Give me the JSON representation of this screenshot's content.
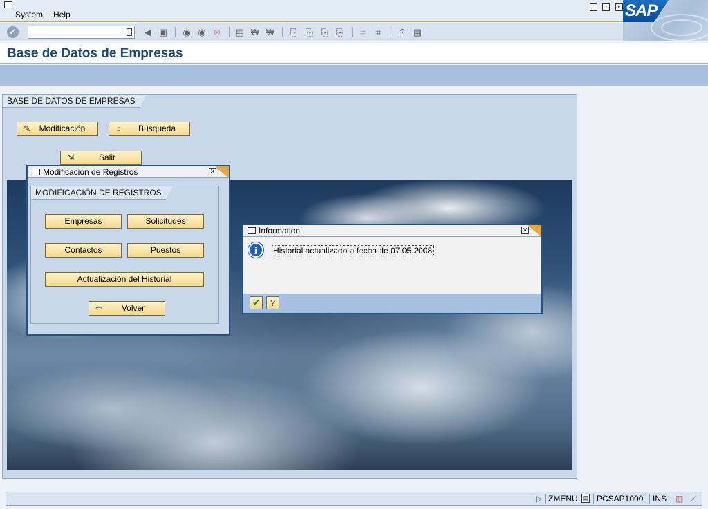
{
  "menubar": {
    "items": [
      "System",
      "Help"
    ]
  },
  "toolbar": {
    "command_field_value": ""
  },
  "title": "Base de Datos de Empresas",
  "main_group": {
    "title": "BASE DE DATOS DE EMPRESAS",
    "buttons": {
      "modificacion": "Modificación",
      "busqueda": "Búsqueda",
      "salir": "Salir"
    }
  },
  "dialog_modificacion": {
    "title": "Modificación de Registros",
    "group_title": "MODIFICACIÓN DE REGISTROS",
    "buttons": {
      "empresas": "Empresas",
      "solicitudes": "Solicitudes",
      "contactos": "Contactos",
      "puestos": "Puestos",
      "historial": "Actualización del Historial",
      "volver": "Volver"
    }
  },
  "dialog_info": {
    "title": "Information",
    "message": "Historial actualizado a fecha de 07.05.2008"
  },
  "statusbar": {
    "transaction": "ZMENU",
    "server": "PCSAP1000",
    "mode": "INS"
  },
  "colors": {
    "accent_orange": "#e0a040",
    "title_blue": "#1c4a76",
    "button_yellow": "#f5d98c"
  },
  "logo_text": "SAP"
}
